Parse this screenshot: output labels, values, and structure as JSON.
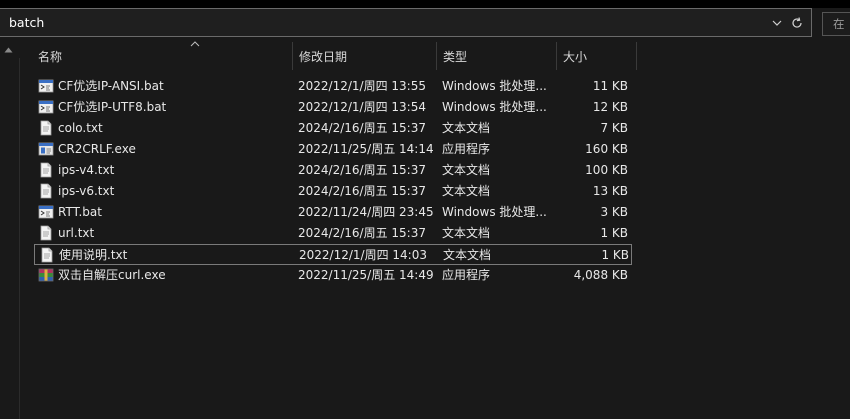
{
  "address": {
    "path": "batch",
    "search_placeholder": "在"
  },
  "columns": {
    "name": "名称",
    "date": "修改日期",
    "type": "类型",
    "size": "大小"
  },
  "files": [
    {
      "name": "CF优选IP-ANSI.bat",
      "date": "2022/12/1/周四 13:55",
      "type": "Windows 批处理...",
      "size": "11 KB",
      "icon": "batch-file-icon"
    },
    {
      "name": "CF优选IP-UTF8.bat",
      "date": "2022/12/1/周四 13:54",
      "type": "Windows 批处理...",
      "size": "12 KB",
      "icon": "batch-file-icon"
    },
    {
      "name": "colo.txt",
      "date": "2024/2/16/周五 15:37",
      "type": "文本文档",
      "size": "7 KB",
      "icon": "text-file-icon"
    },
    {
      "name": "CR2CRLF.exe",
      "date": "2022/11/25/周五 14:14",
      "type": "应用程序",
      "size": "160 KB",
      "icon": "exe-file-icon"
    },
    {
      "name": "ips-v4.txt",
      "date": "2024/2/16/周五 15:37",
      "type": "文本文档",
      "size": "100 KB",
      "icon": "text-file-icon"
    },
    {
      "name": "ips-v6.txt",
      "date": "2024/2/16/周五 15:37",
      "type": "文本文档",
      "size": "13 KB",
      "icon": "text-file-icon"
    },
    {
      "name": "RTT.bat",
      "date": "2022/11/24/周四 23:45",
      "type": "Windows 批处理...",
      "size": "3 KB",
      "icon": "batch-file-icon"
    },
    {
      "name": "url.txt",
      "date": "2024/2/16/周五 15:37",
      "type": "文本文档",
      "size": "1 KB",
      "icon": "text-file-icon"
    },
    {
      "name": "使用说明.txt",
      "date": "2022/12/1/周四 14:03",
      "type": "文本文档",
      "size": "1 KB",
      "icon": "text-file-icon",
      "selected": true
    },
    {
      "name": "双击自解压curl.exe",
      "date": "2022/11/25/周五 14:49",
      "type": "应用程序",
      "size": "4,088 KB",
      "icon": "archive-exe-icon"
    }
  ]
}
